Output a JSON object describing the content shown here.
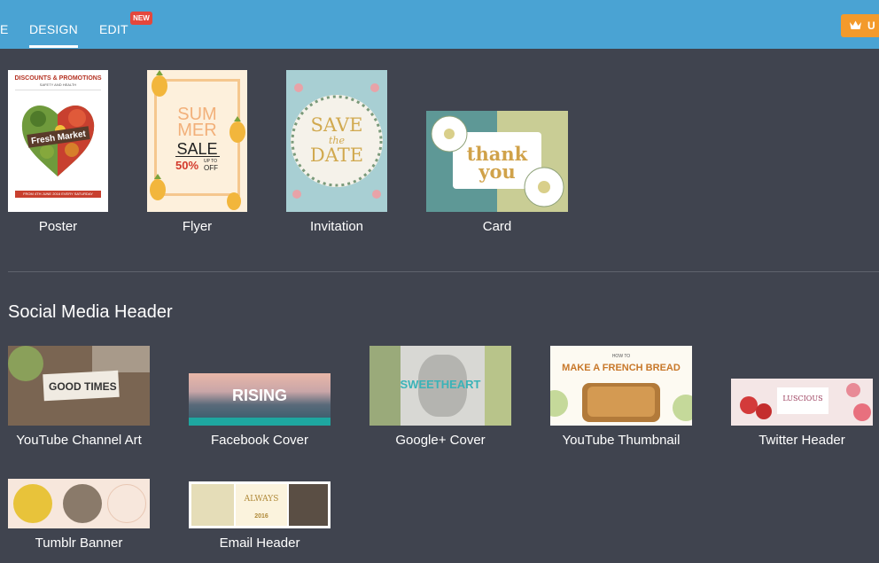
{
  "nav": {
    "partial_label": "E",
    "design_label": "DESIGN",
    "edit_label": "EDIT",
    "new_badge": "NEW",
    "upgrade_label": "U"
  },
  "design_types": [
    {
      "label": "Poster",
      "icon": "poster-thumbnail"
    },
    {
      "label": "Flyer",
      "icon": "flyer-thumbnail"
    },
    {
      "label": "Invitation",
      "icon": "invitation-thumbnail"
    },
    {
      "label": "Card",
      "icon": "card-thumbnail"
    }
  ],
  "poster": {
    "title": "DISCOUNTS & PROMOTIONS",
    "subtitle": "SAFETY AND HEALTH",
    "banner": "Fresh Market",
    "date": "FROM 4TH JUNE 2016 EVERY SATURDAY"
  },
  "flyer": {
    "line1": "SUM",
    "line2": "MER",
    "sale": "SALE",
    "percent": "50%",
    "upto": "UP TO",
    "off": "OFF"
  },
  "invitation": {
    "line1": "SAVE",
    "line2": "the",
    "line3": "DATE"
  },
  "card": {
    "line1": "thank",
    "line2": "you"
  },
  "social_section": {
    "title": "Social Media Header"
  },
  "social_headers": [
    {
      "label": "YouTube Channel Art"
    },
    {
      "label": "Facebook Cover"
    },
    {
      "label": "Google+ Cover"
    },
    {
      "label": "YouTube Thumbnail"
    },
    {
      "label": "Twitter Header"
    },
    {
      "label": "Tumblr Banner"
    },
    {
      "label": "Email Header"
    }
  ],
  "yt_art": {
    "text": "GOOD TIMES"
  },
  "fb_cover": {
    "text": "RISING"
  },
  "gplus": {
    "text": "SWEETHEART"
  },
  "yt_thumb": {
    "howto": "HOW TO",
    "text": "MAKE A FRENCH BREAD"
  },
  "twitter": {
    "text": "LUSCIOUS"
  },
  "email": {
    "text": "ALWAYS",
    "year": "2016"
  },
  "colors": {
    "topbar": "#4aa3d3",
    "background": "#40444f",
    "badge": "#e4473c",
    "upgrade": "#f39a2b"
  }
}
